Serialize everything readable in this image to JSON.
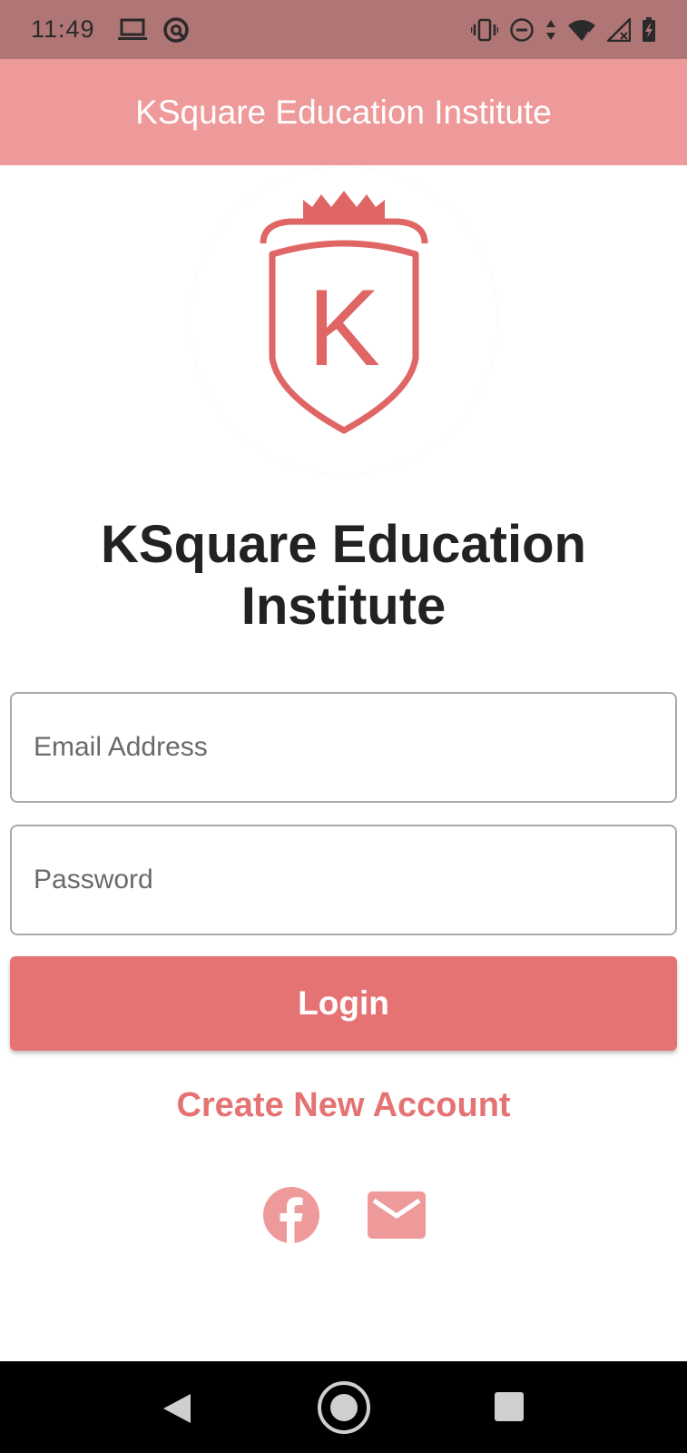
{
  "status_bar": {
    "time": "11:49",
    "icons": [
      "laptop-icon",
      "at-sync-icon",
      "vibrate-icon",
      "do-not-disturb-icon",
      "data-arrows-icon",
      "wifi-icon",
      "signal-icon",
      "battery-icon"
    ]
  },
  "app_bar": {
    "title": "KSquare Education Institute"
  },
  "logo": {
    "letter": "K",
    "icon": "ksquare-shield-logo"
  },
  "main": {
    "title": "KSquare Education Institute",
    "email_placeholder": "Email Address",
    "email_value": "",
    "password_placeholder": "Password",
    "password_value": "",
    "login_label": "Login",
    "create_account_label": "Create New Account",
    "social": [
      "facebook-icon",
      "mail-icon"
    ]
  },
  "colors": {
    "status_bar": "#b07575",
    "app_bar": "#ef9a9a",
    "accent": "#e57373",
    "logo_red": "#e06666",
    "text_dark": "#222222"
  },
  "nav_bar": {
    "buttons": [
      "back-icon",
      "home-icon",
      "recent-apps-icon"
    ]
  }
}
